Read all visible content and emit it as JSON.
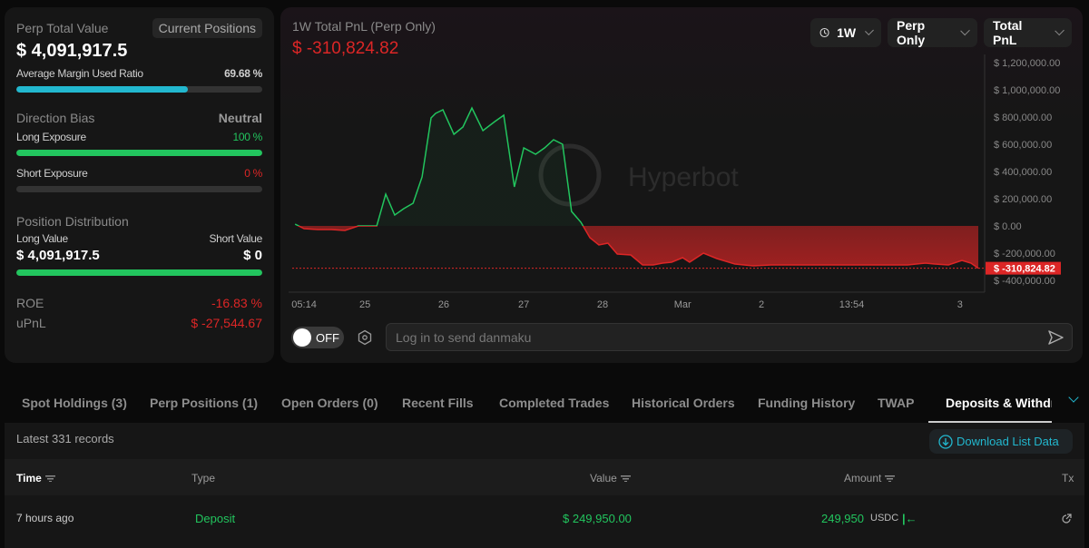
{
  "left": {
    "perp_total_label": "Perp Total Value",
    "current_positions": "Current Positions",
    "perp_total_value": "$ 4,091,917.5",
    "margin_label": "Average Margin Used Ratio",
    "margin_value": "69.68 %",
    "margin_ratio": 69.68,
    "direction_label": "Direction Bias",
    "direction_value": "Neutral",
    "long_exp_label": "Long Exposure",
    "long_exp_value": "100 %",
    "long_exp_pct": 100,
    "short_exp_label": "Short Exposure",
    "short_exp_value": "0 %",
    "short_exp_pct": 0,
    "dist_label": "Position Distribution",
    "long_value_label": "Long Value",
    "short_value_label": "Short Value",
    "long_value": "$ 4,091,917.5",
    "short_value": "$ 0",
    "long_share_pct": 100,
    "roe_label": "ROE",
    "roe_value": "-16.83 %",
    "upnl_label": "uPnL",
    "upnl_value": "$ -27,544.67"
  },
  "chart": {
    "title": "1W Total PnL (Perp Only)",
    "value": "$ -310,824.82",
    "range": "1W",
    "scope": "Perp Only",
    "metric": "Total PnL",
    "watermark": "Hyperbot",
    "toggle": "OFF",
    "danmaku_placeholder": "Log in to send danmaku"
  },
  "chart_data": {
    "type": "area",
    "title": "1W Total PnL (Perp Only)",
    "xlabel": "",
    "ylabel": "",
    "ylim": [
      -400000,
      1200000
    ],
    "yticks": [
      {
        "v": 1200000,
        "label": "$ 1,200,000.00"
      },
      {
        "v": 1000000,
        "label": "$ 1,000,000.00"
      },
      {
        "v": 800000,
        "label": "$ 800,000.00"
      },
      {
        "v": 600000,
        "label": "$ 600,000.00"
      },
      {
        "v": 400000,
        "label": "$ 400,000.00"
      },
      {
        "v": 200000,
        "label": "$ 200,000.00"
      },
      {
        "v": 0,
        "label": "$ 0.00"
      },
      {
        "v": -200000,
        "label": "$ -200,000.00"
      },
      {
        "v": -400000,
        "label": "$ -400,000.00"
      }
    ],
    "xlim_hours": [
      0,
      168
    ],
    "xticks": [
      {
        "t": 2.9,
        "label": "05:14"
      },
      {
        "t": 17.8,
        "label": "25"
      },
      {
        "t": 37.1,
        "label": "26"
      },
      {
        "t": 56.7,
        "label": "27"
      },
      {
        "t": 76,
        "label": "28"
      },
      {
        "t": 95.6,
        "label": "Mar"
      },
      {
        "t": 114.9,
        "label": "2"
      },
      {
        "t": 137,
        "label": "13:54"
      },
      {
        "t": 163.5,
        "label": "3"
      }
    ],
    "current": {
      "v": -310824.82,
      "label": "$ -310,824.82"
    },
    "x_hours": [
      0.7,
      2.9,
      6.2,
      9.6,
      12.9,
      16.2,
      19.6,
      20.7,
      22.9,
      25.1,
      27.3,
      29.6,
      31.8,
      34,
      35.1,
      36.9,
      39.6,
      41.8,
      44,
      46.7,
      49.6,
      51.8,
      54.4,
      56.7,
      59.6,
      61.8,
      64,
      66.2,
      68.4,
      70.7,
      72.9,
      75.1,
      77.3,
      79.6,
      82.9,
      85.8,
      88.4,
      90.7,
      92.9,
      95.6,
      97.3,
      100.7,
      104,
      108.4,
      112.9,
      117.3,
      128.4,
      139.6,
      150.7,
      155.1,
      157.3,
      160.7,
      164,
      166.2,
      168
    ],
    "values": [
      13333,
      -20000,
      -26667,
      -26667,
      -33333,
      0,
      0,
      0,
      233333,
      80000,
      126667,
      166667,
      360000,
      793333,
      826667,
      853333,
      673333,
      726667,
      866667,
      700000,
      766667,
      813333,
      286667,
      573333,
      526667,
      573333,
      633333,
      600000,
      106667,
      26667,
      -86667,
      -140000,
      -126667,
      -206667,
      -213333,
      -286667,
      -286667,
      -273333,
      -266667,
      -233333,
      -266667,
      -200000,
      -240000,
      -280000,
      -293333,
      -286667,
      -286667,
      -286667,
      -286667,
      -273333,
      -280000,
      -286667,
      -253333,
      -273333,
      -310824.82
    ]
  },
  "tabs": [
    "Spot Holdings (3)",
    "Perp Positions (1)",
    "Open Orders (0)",
    "Recent Fills",
    "Completed Trades",
    "Historical Orders",
    "Funding History",
    "TWAP",
    "Deposits & Withdraw"
  ],
  "table": {
    "records": "Latest 331 records",
    "download": "Download List Data",
    "headers": {
      "time": "Time",
      "type": "Type",
      "value": "Value",
      "amount": "Amount",
      "tx": "Tx"
    },
    "rows": [
      {
        "time": "7 hours ago",
        "type": "Deposit",
        "value": "$ 249,950.00",
        "amount": "249,950",
        "unit": "USDC"
      }
    ]
  },
  "colors": {
    "green": "#22c55e",
    "red": "#dc2626",
    "cyan": "#22b8cf"
  }
}
